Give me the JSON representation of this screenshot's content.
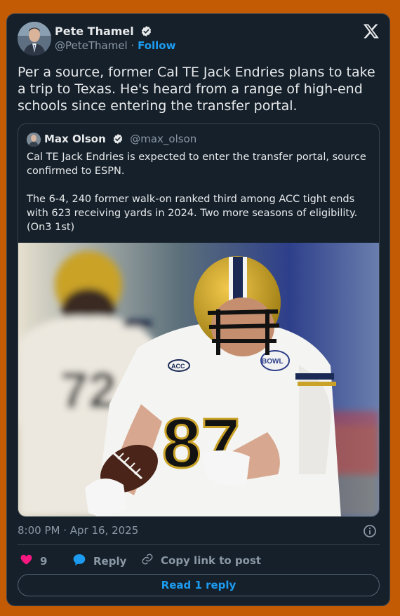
{
  "author": {
    "name": "Pete Thamel",
    "handle": "@PeteThamel",
    "separator": "·",
    "follow_label": "Follow"
  },
  "tweet": {
    "text": "Per a source, former Cal TE Jack Endries plans to take a trip to Texas. He's heard from a range of high-end schools since entering the transfer portal."
  },
  "quote": {
    "name": "Max Olson",
    "handle": "@max_olson",
    "text": "Cal TE Jack Endries is expected to enter the transfer portal, source confirmed to ESPN.\n\nThe 6-4, 240 former walk-on ranked third among ACC tight ends with 623 receiving yards in 2024. Two more seasons of eligibility. (On3 1st)",
    "image": {
      "player_number": "87",
      "background_number": "72",
      "patch_text": "ACC",
      "bowl_text": "BOWL"
    }
  },
  "timestamp": "8:00 PM · Apr 16, 2025",
  "actions": {
    "likes_count": "9",
    "reply_label": "Reply",
    "copy_label": "Copy link to post"
  },
  "read_reply_label": "Read 1 reply",
  "colors": {
    "background": "#c35a04",
    "card": "#15202b",
    "accent": "#1d9bf0",
    "like": "#f91880"
  },
  "icons": [
    "verified-badge-icon",
    "x-logo-icon",
    "info-icon",
    "heart-icon",
    "reply-bubble-icon",
    "link-icon"
  ]
}
